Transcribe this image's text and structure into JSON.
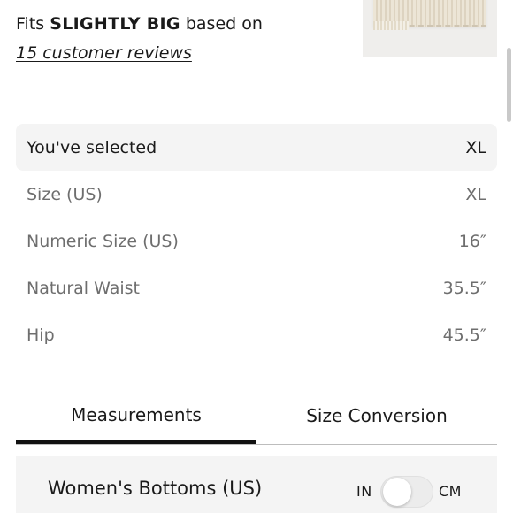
{
  "fit": {
    "prefix": "Fits ",
    "emphasis": "SLIGHTLY BIG",
    "suffix": " based on",
    "reviews_link": "15 customer reviews"
  },
  "product_thumbnail": {
    "icon": "product-image"
  },
  "size_table": {
    "rows": [
      {
        "label": "You've selected",
        "value": "XL"
      },
      {
        "label": "Size (US)",
        "value": "XL"
      },
      {
        "label": "Numeric Size (US)",
        "value": "16″"
      },
      {
        "label": "Natural Waist",
        "value": "35.5″"
      },
      {
        "label": "Hip",
        "value": "45.5″"
      }
    ]
  },
  "tabs": [
    {
      "label": "Measurements",
      "active": true
    },
    {
      "label": "Size Conversion",
      "active": false
    }
  ],
  "conversion_panel": {
    "title": "Women's Bottoms (US)",
    "unit_left": "IN",
    "unit_right": "CM",
    "selected_unit": "IN"
  },
  "colors": {
    "selected_row_bg": "#f4f4f4",
    "active_tab_underline": "#111111",
    "muted_text": "#6e6e6e"
  }
}
